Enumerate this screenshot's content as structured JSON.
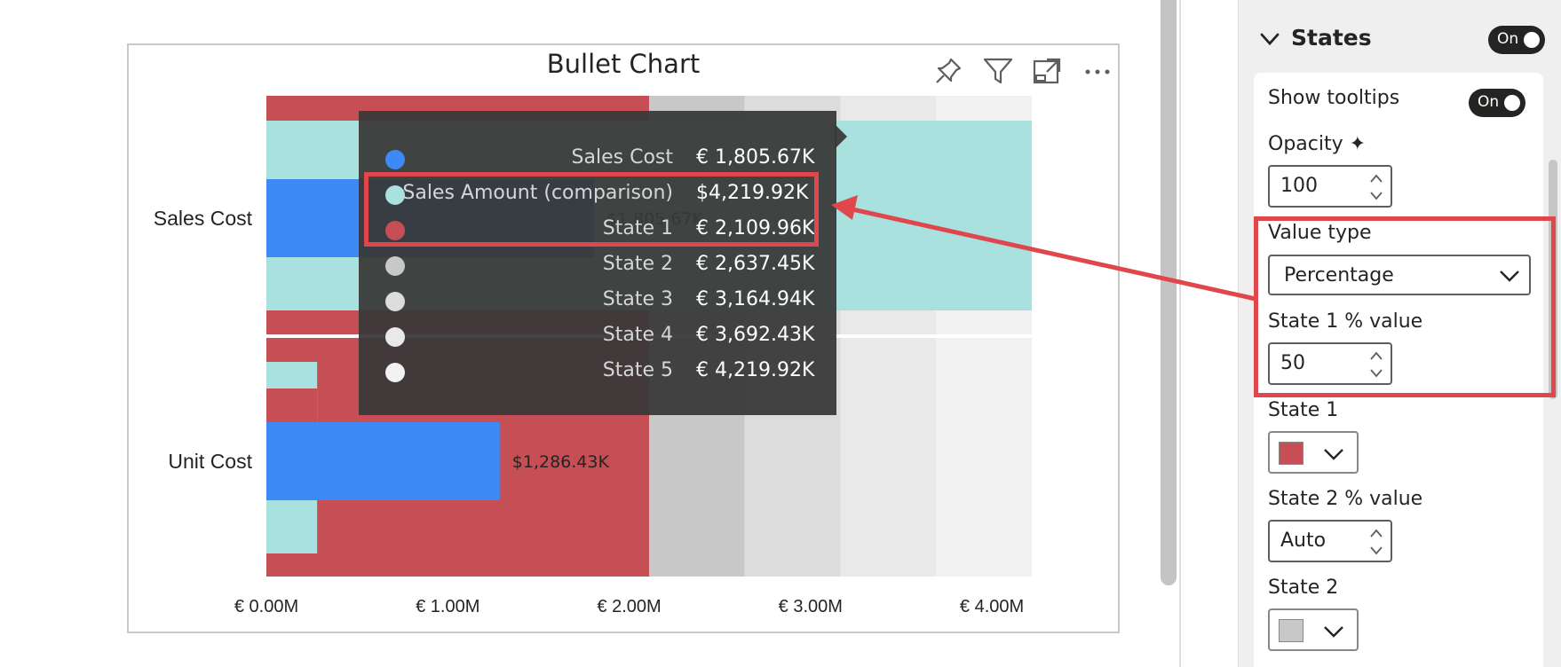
{
  "colors": {
    "state1": "#c64e55",
    "state2": "#c8c8c8",
    "state3": "#dcdcdc",
    "state4": "#e9e9e9",
    "state5": "#f1f1f1",
    "sales_cost_bar": "#3d89f5",
    "comparison_bar": "#a8e1dd",
    "annotation": "#e0474c",
    "axis_line": "#ffffff"
  },
  "chart_data": {
    "type": "bar",
    "title": "Bullet Chart",
    "orientation": "horizontal",
    "categories": [
      "Sales Cost",
      "Unit Cost"
    ],
    "xlim": [
      0,
      4.22
    ],
    "xticks": [
      "€ 0.00M",
      "€ 1.00M",
      "€ 2.00M",
      "€ 3.00M",
      "€ 4.00M"
    ],
    "xtick_values": [
      0,
      1,
      2,
      3,
      4
    ],
    "series": [
      {
        "name": "Sales Cost",
        "values": [
          1.80567,
          1.28643
        ]
      },
      {
        "name": "Sales Amount (comparison)",
        "values": [
          4.21992,
          0.28
        ]
      }
    ],
    "states": [
      2.10996,
      2.63745,
      3.16494,
      3.69243,
      4.21992
    ],
    "data_labels": [
      "$1,805.67K",
      "$1,286.43K"
    ]
  },
  "tooltip": {
    "rows": [
      {
        "label": "Sales Cost",
        "value": "€ 1,805.67K",
        "color": "#3d89f5"
      },
      {
        "label": "Sales Amount (comparison)",
        "value": "$4,219.92K",
        "color": "#a8e1dd"
      },
      {
        "label": "State 1",
        "value": "€ 2,109.96K",
        "color": "#c64e55"
      },
      {
        "label": "State 2",
        "value": "€ 2,637.45K",
        "color": "#c8c8c8"
      },
      {
        "label": "State 3",
        "value": "€ 3,164.94K",
        "color": "#dcdcdc"
      },
      {
        "label": "State 4",
        "value": "€ 3,692.43K",
        "color": "#e9e9e9"
      },
      {
        "label": "State 5",
        "value": "€ 4,219.92K",
        "color": "#f1f1f1"
      }
    ]
  },
  "visual_header": {
    "icons": [
      "pin-icon",
      "filter-icon",
      "focus-mode-icon",
      "more-options-icon"
    ]
  },
  "format_pane": {
    "card_title": "States",
    "card_toggle": "On",
    "show_tooltips_label": "Show tooltips",
    "show_tooltips_toggle": "On",
    "opacity_label": "Opacity ✦",
    "opacity_value": "100",
    "value_type_label": "Value type",
    "value_type_value": "Percentage",
    "state1_pct_label": "State 1 % value",
    "state1_pct_value": "50",
    "state1_label": "State 1",
    "state2_pct_label": "State 2 % value",
    "state2_pct_value": "Auto",
    "state2_label": "State 2"
  }
}
